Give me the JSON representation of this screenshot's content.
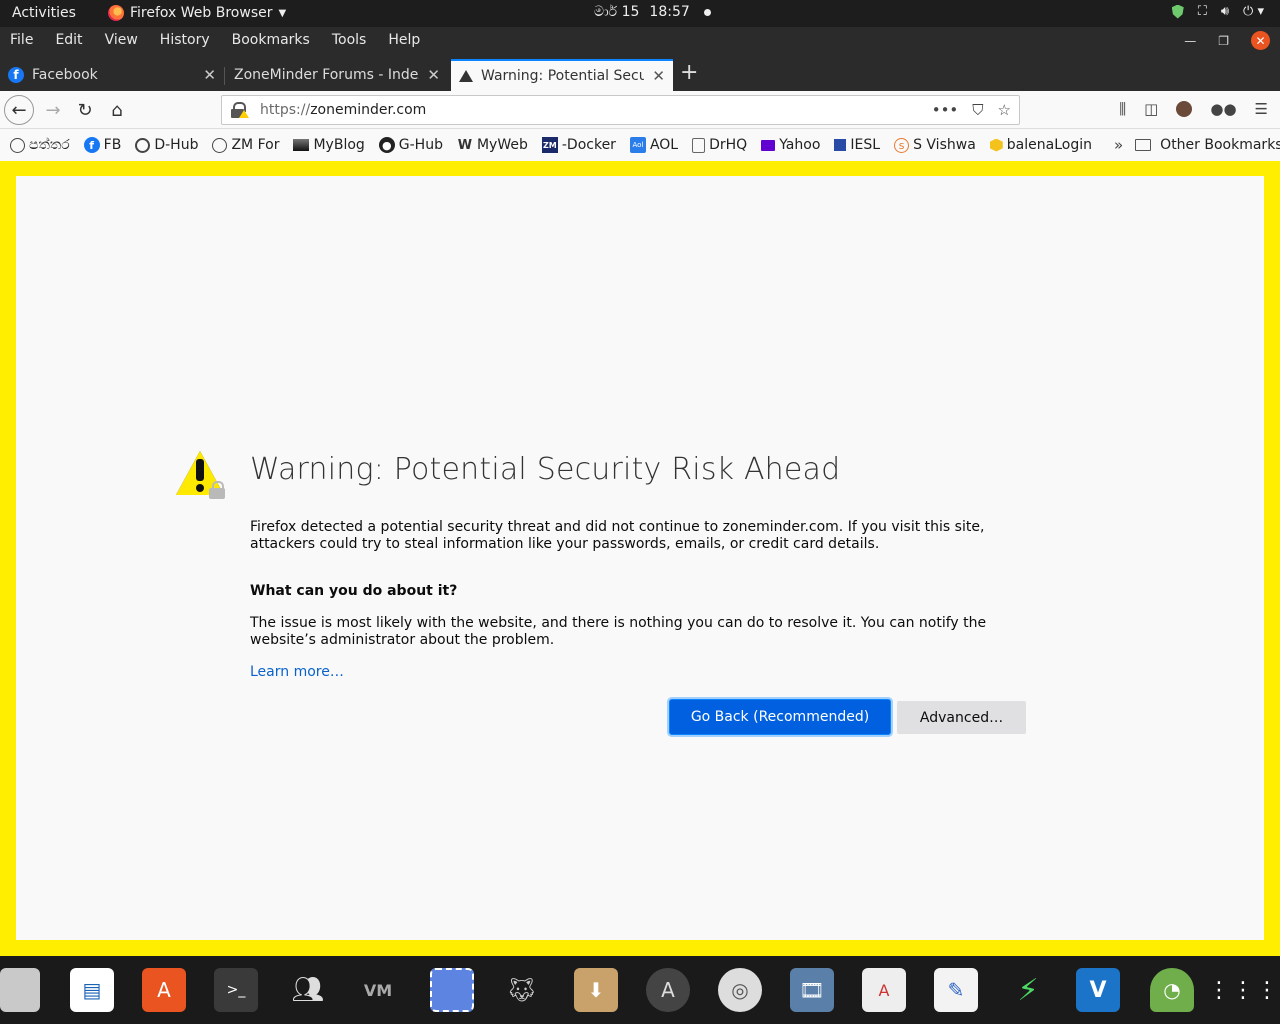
{
  "topbar": {
    "activities": "Activities",
    "app_name": "Firefox Web Browser",
    "date": "මාර් 15",
    "time": "18:57"
  },
  "menu": [
    "File",
    "Edit",
    "View",
    "History",
    "Bookmarks",
    "Tools",
    "Help"
  ],
  "tabs": [
    {
      "title": "Facebook"
    },
    {
      "title": "ZoneMinder Forums - Index"
    },
    {
      "title": "Warning: Potential Security Risk Ahead"
    }
  ],
  "url": {
    "proto": "https://",
    "host": "zoneminder.com"
  },
  "bookmarks": [
    "පත්තර",
    "FB",
    "D-Hub",
    "ZM For",
    "MyBlog",
    "G-Hub",
    "MyWeb",
    "-Docker",
    "AOL",
    "DrHQ",
    "Yahoo",
    "IESL",
    "S Vishwa",
    "balenaLogin"
  ],
  "other_bookmarks": "Other Bookmarks",
  "error": {
    "title": "Warning: Potential Security Risk Ahead",
    "desc": "Firefox detected a potential security threat and did not continue to zoneminder.com. If you visit this site, attackers could try to steal information like your passwords, emails, or credit card details.",
    "subtitle": "What can you do about it?",
    "desc2": "The issue is most likely with the website, and there is nothing you can do to resolve it. You can notify the website’s administrator about the problem.",
    "learn_more": "Learn more…",
    "go_back": "Go Back (Recommended)",
    "advanced": "Advanced…"
  },
  "colors": {
    "accent": "#0060df",
    "frame": "#ffee00",
    "dock": "#1a1a1a"
  }
}
